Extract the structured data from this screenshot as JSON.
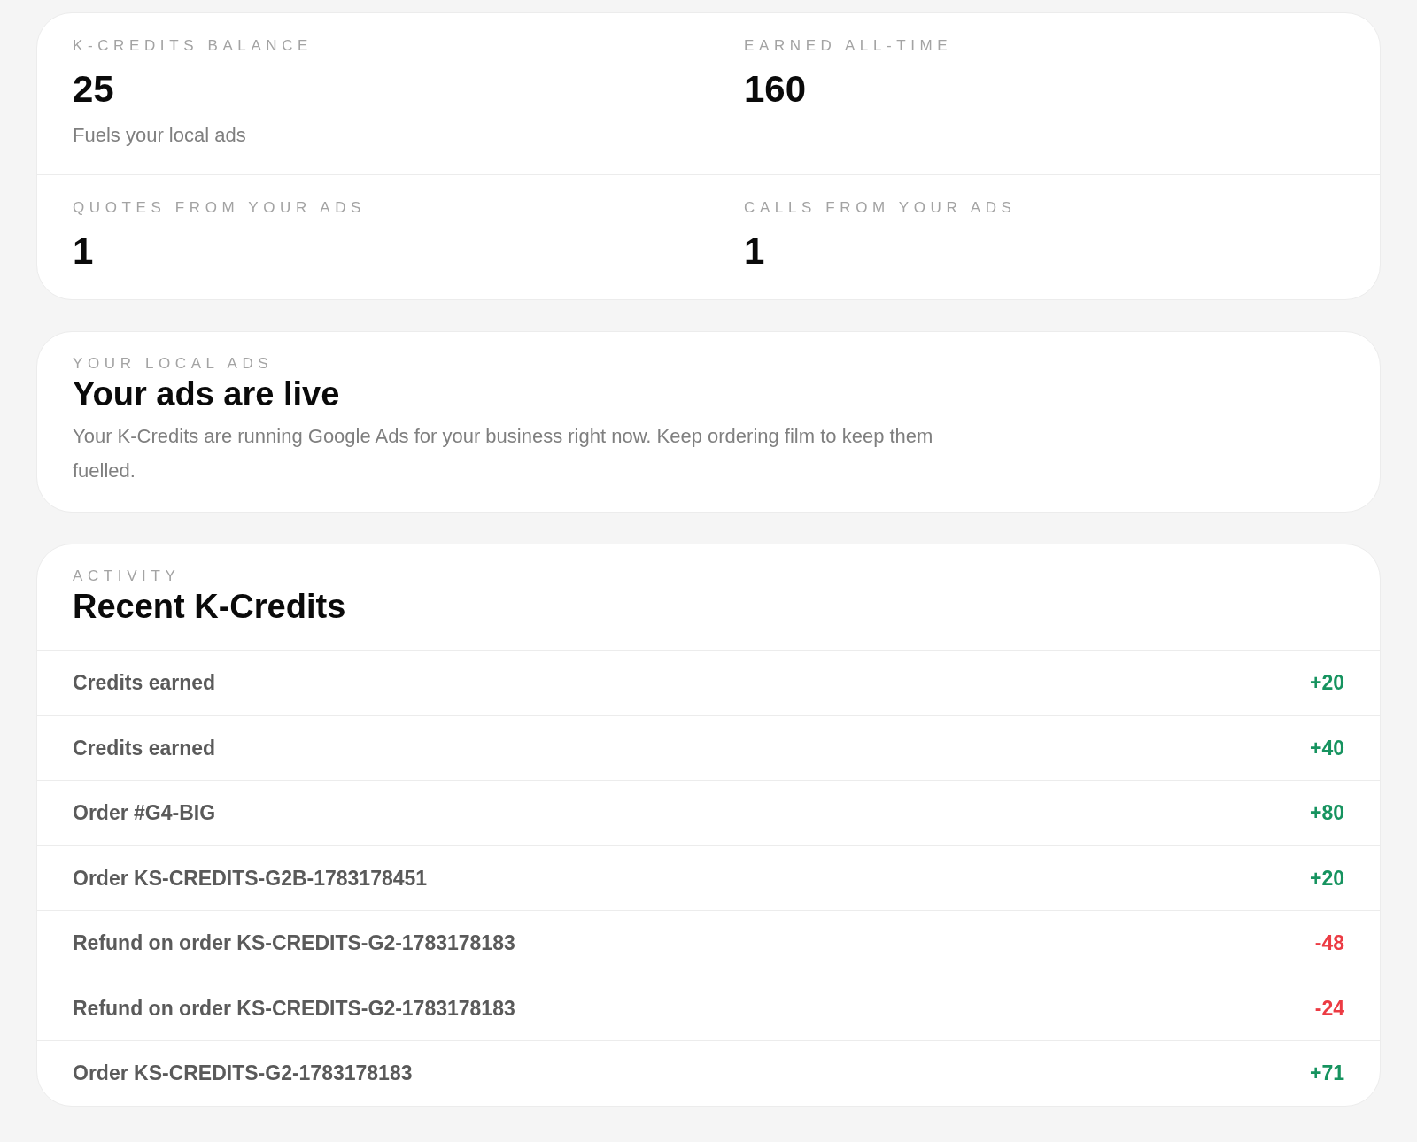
{
  "stats": [
    {
      "label": "K-CREDITS BALANCE",
      "value": "25",
      "note": "Fuels your local ads"
    },
    {
      "label": "EARNED ALL-TIME",
      "value": "160"
    },
    {
      "label": "QUOTES FROM YOUR ADS",
      "value": "1"
    },
    {
      "label": "CALLS FROM YOUR ADS",
      "value": "1"
    }
  ],
  "ads_card": {
    "eyebrow": "YOUR LOCAL ADS",
    "title": "Your ads are live",
    "description": "Your K-Credits are running Google Ads for your business right now. Keep ordering film to keep them fuelled."
  },
  "activity": {
    "eyebrow": "ACTIVITY",
    "title": "Recent K-Credits",
    "rows": [
      {
        "description": "Credits earned",
        "amount": "+20",
        "color": "#16935f"
      },
      {
        "description": "Credits earned",
        "amount": "+40",
        "color": "#16935f"
      },
      {
        "description": "Order #G4-BIG",
        "amount": "+80",
        "color": "#16935f"
      },
      {
        "description": "Order KS-CREDITS-G2B-1783178451",
        "amount": "+20",
        "color": "#16935f"
      },
      {
        "description": "Refund on order KS-CREDITS-G2-1783178183",
        "amount": "-48",
        "color": "#ec3b43"
      },
      {
        "description": "Refund on order KS-CREDITS-G2-1783178183",
        "amount": "-24",
        "color": "#ec3b43"
      },
      {
        "description": "Order KS-CREDITS-G2-1783178183",
        "amount": "+71",
        "color": "#16935f"
      }
    ]
  }
}
